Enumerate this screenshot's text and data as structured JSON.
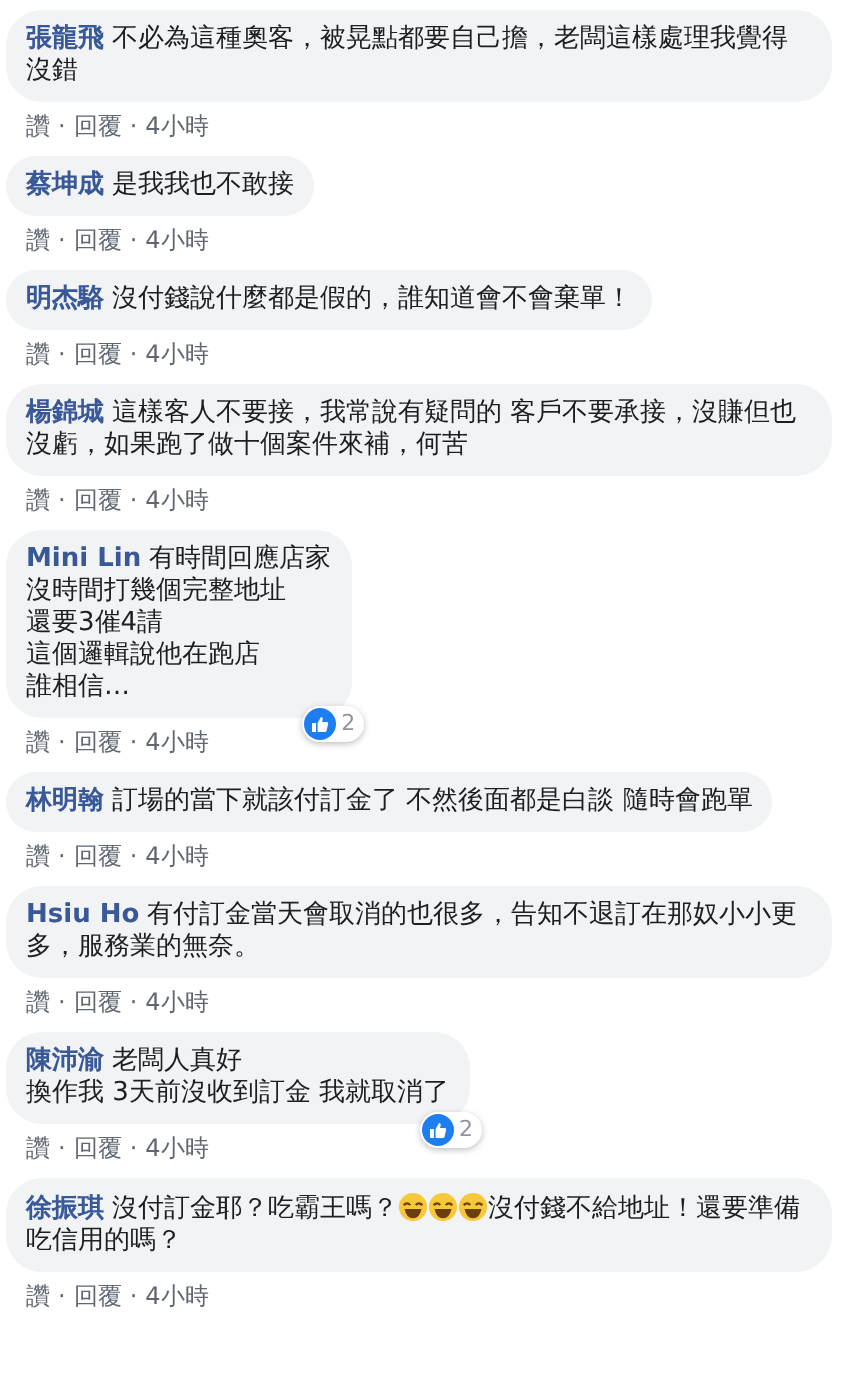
{
  "comments": [
    {
      "author": "張龍飛",
      "body": [
        {
          "kind": "text",
          "text": "不必為這種奧客，被晃點都要自己擔，老闆這樣處理我覺得沒錯"
        }
      ],
      "actions": [
        "讚",
        "·",
        "回覆",
        "·",
        "4小時"
      ]
    },
    {
      "author": "蔡坤成",
      "body": [
        {
          "kind": "text",
          "text": "是我我也不敢接"
        }
      ],
      "actions": [
        "讚",
        "·",
        "回覆",
        "·",
        "4小時"
      ]
    },
    {
      "author": "明杰駱",
      "body": [
        {
          "kind": "text",
          "text": "沒付錢說什麼都是假的，誰知道會不會棄單！"
        }
      ],
      "actions": [
        "讚",
        "·",
        "回覆",
        "·",
        "4小時"
      ]
    },
    {
      "author": "楊錦城",
      "body": [
        {
          "kind": "text",
          "text": "這樣客人不要接，我常說有疑問的 客戶不要承接，沒賺但也沒虧，如果跑了做十個案件來補，何苦"
        }
      ],
      "actions": [
        "讚",
        "·",
        "回覆",
        "·",
        "4小時"
      ]
    },
    {
      "author": "Mini Lin",
      "body": [
        {
          "kind": "text",
          "text": "有時間回應店家"
        },
        {
          "kind": "newline"
        },
        {
          "kind": "text",
          "text": "沒時間打幾個完整地址"
        },
        {
          "kind": "newline"
        },
        {
          "kind": "text",
          "text": "還要3催4請"
        },
        {
          "kind": "newline"
        },
        {
          "kind": "text",
          "text": "這個邏輯說他在跑店"
        },
        {
          "kind": "newline"
        },
        {
          "kind": "text",
          "text": "誰相信…"
        }
      ],
      "reactions": "2",
      "actions": [
        "讚",
        "·",
        "回覆",
        "·",
        "4小時"
      ]
    },
    {
      "author": "林明翰",
      "body": [
        {
          "kind": "text",
          "text": "訂場的當下就該付訂金了 不然後面都是白談 隨時會跑單"
        }
      ],
      "actions": [
        "讚",
        "·",
        "回覆",
        "·",
        "4小時"
      ]
    },
    {
      "author": "Hsiu Ho",
      "body": [
        {
          "kind": "text",
          "text": "有付訂金當天會取消的也很多，告知不退訂在那奴小小更多，服務業的無奈。"
        }
      ],
      "actions": [
        "讚",
        "·",
        "回覆",
        "·",
        "4小時"
      ]
    },
    {
      "author": "陳沛渝",
      "body": [
        {
          "kind": "text",
          "text": "老闆人真好"
        },
        {
          "kind": "newline"
        },
        {
          "kind": "text",
          "text": "換作我 3天前沒收到訂金 我就取消了"
        }
      ],
      "reactions": "2",
      "actions": [
        "讚",
        "·",
        "回覆",
        "·",
        "4小時"
      ]
    },
    {
      "author": "徐振琪",
      "body": [
        {
          "kind": "text",
          "text": "沒付訂金耶？吃霸王嗎？"
        },
        {
          "kind": "emoji"
        },
        {
          "kind": "emoji"
        },
        {
          "kind": "emoji"
        },
        {
          "kind": "text",
          "text": "沒付錢不給地址！還要準備吃信用的嗎？"
        }
      ],
      "actions": [
        "讚",
        "·",
        "回覆",
        "·",
        "4小時"
      ]
    }
  ]
}
